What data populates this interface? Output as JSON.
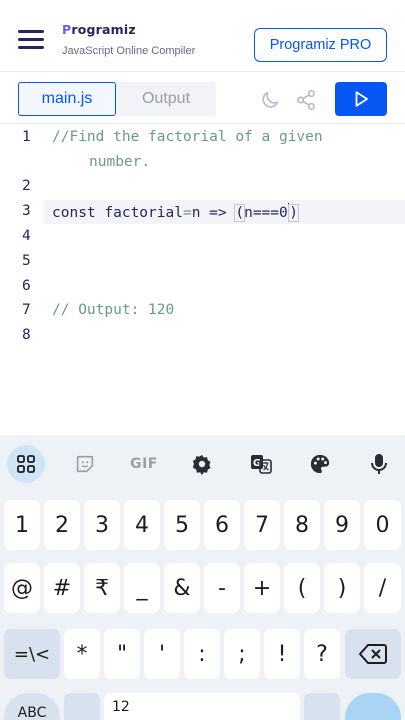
{
  "header": {
    "logo_text": "rogramiz",
    "logo_mark": "P",
    "subtitle": "JavaScript Online Compiler",
    "pro_button": "Programiz PRO"
  },
  "tabs": {
    "main": "main.js",
    "output": "Output"
  },
  "editor": {
    "line_numbers": [
      "1",
      "2",
      "3",
      "4",
      "5",
      "6",
      "7",
      "8"
    ],
    "line1": "//Find the factorial of a given",
    "line1_wrap": "number.",
    "line3_kw": "const",
    "line3_name": " factorial",
    "line3_eq": "=",
    "line3_n": "n",
    "line3_arrow": " => ",
    "line3_paren_open": "(",
    "line3_expr": "n===0",
    "line3_paren_close": ")",
    "line7": "// Output: 120"
  },
  "keyboard": {
    "toolbar": {
      "gif": "GIF"
    },
    "row_numbers": [
      "1",
      "2",
      "3",
      "4",
      "5",
      "6",
      "7",
      "8",
      "9",
      "0"
    ],
    "row_symbols1": [
      "@",
      "#",
      "₹",
      "_",
      "&",
      "-",
      "+",
      "(",
      ")",
      "/"
    ],
    "row_symbols2": [
      "=\\<",
      "*",
      "\"",
      "'",
      ":",
      ";",
      "!",
      "?"
    ],
    "bottom_left": "ABC",
    "bottom_mid": "12"
  },
  "colors": {
    "brand_blue": "#0556f3",
    "navy": "#25265e",
    "comment_green": "#6a9a8e"
  }
}
